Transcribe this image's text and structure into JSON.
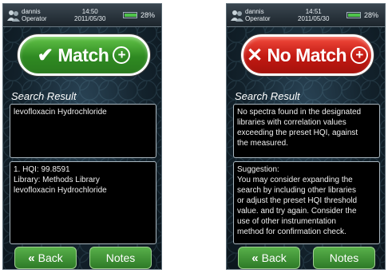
{
  "screens": [
    {
      "status": {
        "user_line1": "dannis",
        "user_line2": "Operator",
        "time": "14:50",
        "date": "2011/05/30",
        "battery": "28%",
        "battery_level": 0.28
      },
      "result_button": {
        "label": "Match",
        "mark": "✔",
        "color": "#3a9a2c"
      },
      "search_result_label": "Search Result",
      "box1": {
        "lines": [
          "levofloxacin Hydrochloride"
        ]
      },
      "box2": {
        "lines": [
          "1. HQI: 99.8591",
          "Library: Methods Library",
          "levofloxacin Hydrochloride"
        ]
      },
      "nav": {
        "back": "Back",
        "notes": "Notes"
      }
    },
    {
      "status": {
        "user_line1": "dannis",
        "user_line2": "Operator",
        "time": "14:51",
        "date": "2011/05/30",
        "battery": "28%",
        "battery_level": 0.28
      },
      "result_button": {
        "label": "No Match",
        "mark": "✕",
        "color": "#c8201a"
      },
      "search_result_label": "Search Result",
      "box1": {
        "lines": [
          "No spectra found in the designated",
          "libraries with correlation values",
          "exceeding the preset HQI, against",
          "the measured."
        ]
      },
      "box2": {
        "lines": [
          "Suggestion:",
          "You may consider expanding the",
          "search by including other libraries",
          "or adjust the preset HQI threshold",
          "value. and try again. Consider the",
          "use of other instrumentation",
          "method for confirmation check."
        ]
      },
      "nav": {
        "back": "Back",
        "notes": "Notes"
      }
    }
  ]
}
